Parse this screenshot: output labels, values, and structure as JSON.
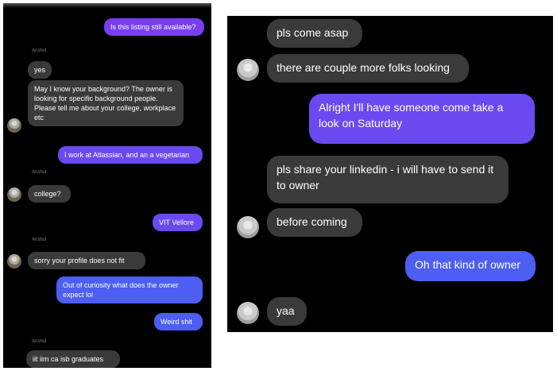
{
  "left_chat": {
    "messages": [
      {
        "text": "Is this listing still available?"
      },
      {
        "sender": "Anshul"
      },
      {
        "text": "yes"
      },
      {
        "text": "May I know your background? The owner is looking for specific background people. Please tell me about your college, workplace etc"
      },
      {
        "text": "I work at Atlassian, and an a vegetarian"
      },
      {
        "sender": "Anshul"
      },
      {
        "text": "college?"
      },
      {
        "text": "VIT Vellore"
      },
      {
        "sender": "Anshul"
      },
      {
        "text": "sorry your profile does not fit"
      },
      {
        "text": "Out of curiosity what does the owner expect lol"
      },
      {
        "text": "Weird shit"
      },
      {
        "sender": "Anshul"
      },
      {
        "text": "iit iim ca isb graduates"
      }
    ]
  },
  "right_chat": {
    "messages": [
      {
        "text": "pls come asap"
      },
      {
        "text": "there are couple more folks looking"
      },
      {
        "text": "Alright I'll have someone come take a look on Saturday"
      },
      {
        "text": "pls share your linkedin - i will have to send it to owner"
      },
      {
        "text": "before coming"
      },
      {
        "text": "Oh that kind of owner"
      },
      {
        "text": "yaa"
      }
    ]
  },
  "colors": {
    "background": "#000000",
    "received_bubble": "#3a3a3a",
    "sent_purple": "#7a3ef0",
    "sent_blue": "#4d5ef2"
  }
}
